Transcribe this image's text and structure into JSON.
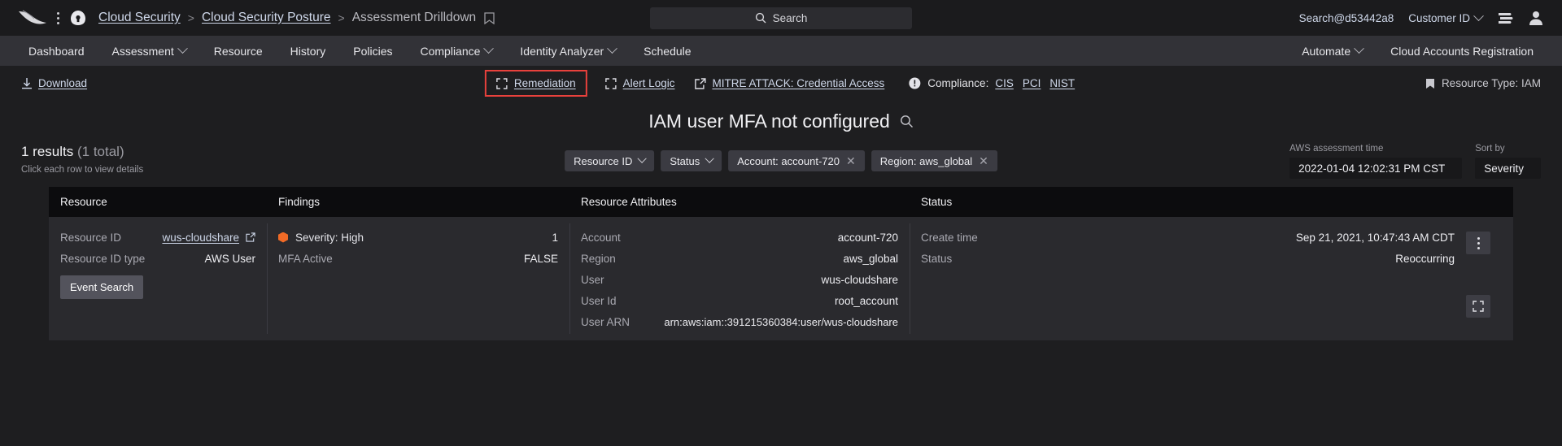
{
  "topbar": {
    "breadcrumbs": [
      {
        "label": "Cloud Security",
        "link": true
      },
      {
        "label": "Cloud Security Posture",
        "link": true
      },
      {
        "label": "Assessment Drilldown",
        "link": false
      }
    ],
    "separator": ">",
    "search_placeholder": "Search",
    "account": "Search@d53442a8",
    "customer_id": "Customer ID"
  },
  "nav": {
    "left_items": [
      {
        "label": "Dashboard",
        "caret": false
      },
      {
        "label": "Assessment",
        "caret": true
      },
      {
        "label": "Resource",
        "caret": false
      },
      {
        "label": "History",
        "caret": false
      },
      {
        "label": "Policies",
        "caret": false
      },
      {
        "label": "Compliance",
        "caret": true
      },
      {
        "label": "Identity Analyzer",
        "caret": true
      },
      {
        "label": "Schedule",
        "caret": false
      }
    ],
    "right_items": [
      {
        "label": "Automate",
        "caret": true
      },
      {
        "label": "Cloud Accounts Registration",
        "caret": false
      }
    ]
  },
  "actionbar": {
    "download": "Download",
    "remediation": "Remediation",
    "alert_logic": "Alert Logic",
    "mitre": "MITRE ATTACK: Credential Access",
    "compliance_label": "Compliance:",
    "compliance_links": [
      "CIS",
      "PCI",
      "NIST"
    ],
    "resource_type": "Resource Type: IAM",
    "highlight_color": "#e8413c"
  },
  "page": {
    "title": "IAM user MFA not configured",
    "results_count": "1 results",
    "results_total": "(1 total)",
    "results_hint": "Click each row to view details"
  },
  "filters": [
    {
      "label": "Resource ID",
      "type": "dropdown"
    },
    {
      "label": "Status",
      "type": "dropdown"
    },
    {
      "label": "Account: account-720",
      "type": "removable"
    },
    {
      "label": "Region: aws_global",
      "type": "removable"
    }
  ],
  "controls": {
    "assessment_time_label": "AWS assessment time",
    "assessment_time_value": "2022-01-04 12:02:31 PM CST",
    "sort_by_label": "Sort by",
    "sort_by_value": "Severity"
  },
  "table": {
    "headers": {
      "resource": "Resource",
      "findings": "Findings",
      "attributes": "Resource Attributes",
      "status": "Status"
    },
    "row": {
      "resource": {
        "rows": [
          {
            "key": "Resource ID",
            "value": "wus-cloudshare",
            "link": true
          },
          {
            "key": "Resource ID type",
            "value": "AWS User",
            "link": false
          }
        ],
        "button": "Event Search"
      },
      "findings": {
        "rows": [
          {
            "key": "Severity: High",
            "value": "1",
            "severity": true,
            "severity_color": "#f06a26"
          },
          {
            "key": "MFA Active",
            "value": "FALSE",
            "severity": false
          }
        ]
      },
      "attributes": {
        "rows": [
          {
            "key": "Account",
            "value": "account-720"
          },
          {
            "key": "Region",
            "value": "aws_global"
          },
          {
            "key": "User",
            "value": "wus-cloudshare"
          },
          {
            "key": "User Id",
            "value": "root_account"
          },
          {
            "key": "User ARN",
            "value": "arn:aws:iam::391215360384:user/wus-cloudshare"
          }
        ]
      },
      "status": {
        "rows": [
          {
            "key": "Create time",
            "value": "Sep 21, 2021, 10:47:43 AM CDT"
          },
          {
            "key": "Status",
            "value": "Reoccurring"
          }
        ]
      }
    }
  }
}
